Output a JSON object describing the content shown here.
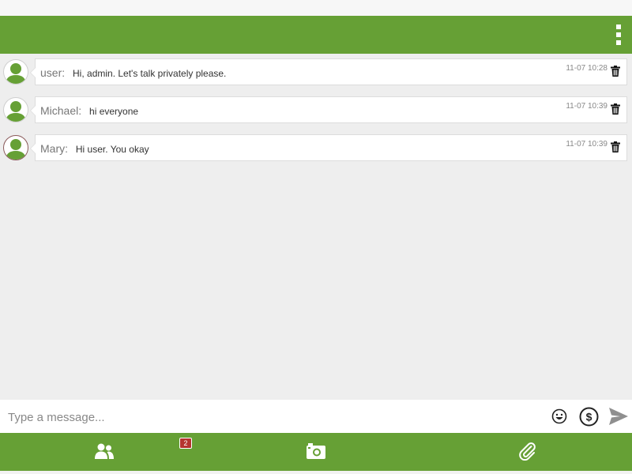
{
  "messages": [
    {
      "sender": "user:",
      "text": "Hi, admin. Let's talk privately please.",
      "time": "11-07 10:28",
      "avatar_icon": "user-avatar-icon"
    },
    {
      "sender": "Michael:",
      "text": "hi everyone",
      "time": "11-07 10:39",
      "avatar_icon": "user-avatar-icon"
    },
    {
      "sender": "Mary:",
      "text": "Hi user. You okay",
      "time": "11-07 10:39",
      "avatar_icon": "user-avatar-icon"
    }
  ],
  "composer": {
    "placeholder": "Type a message...",
    "icons": [
      "emoji-icon",
      "dollar-icon",
      "send-icon"
    ]
  },
  "bottombar": {
    "users_badge": "2",
    "icons": [
      "users-icon",
      "camera-icon",
      "paperclip-icon"
    ]
  },
  "colors": {
    "brand_green": "#66a035",
    "badge_red": "#b5342f",
    "chat_background": "#eeeeee"
  }
}
